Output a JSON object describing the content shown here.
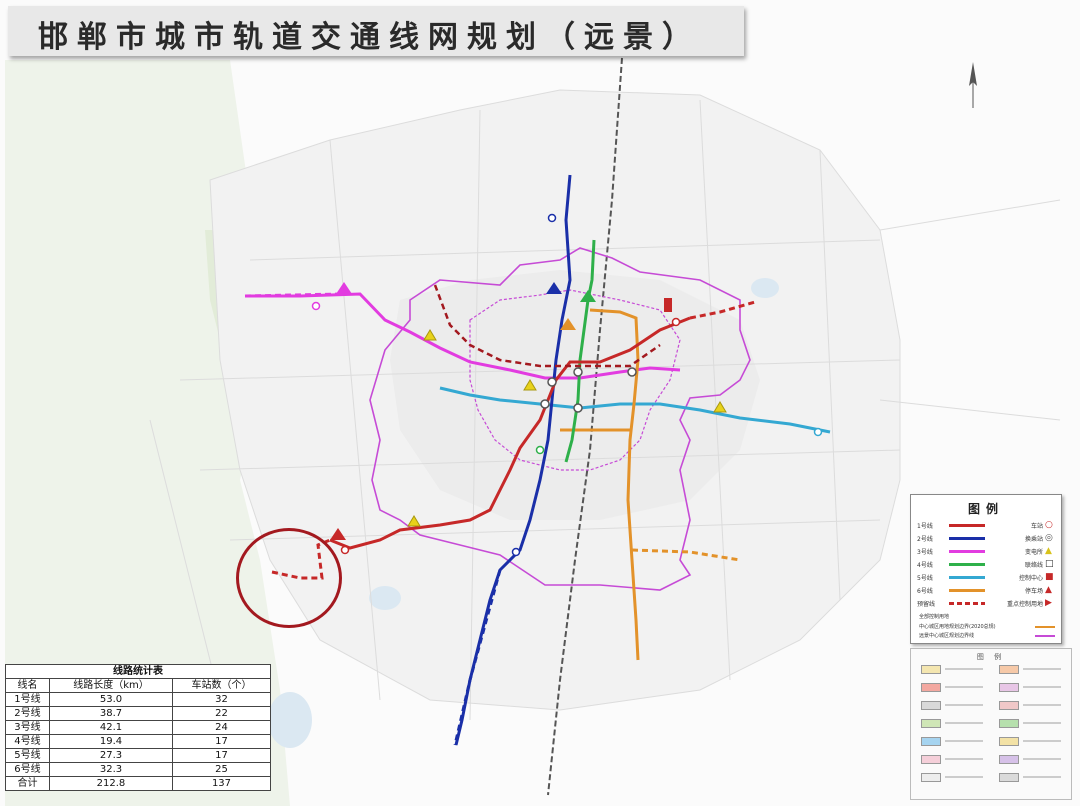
{
  "map": {
    "title": "邯郸市城市轨道交通线网规划（远景）"
  },
  "line_colors": {
    "line1": "#c62828",
    "line2": "#1a2fa8",
    "line3": "#e23ce0",
    "line4": "#2eb04a",
    "line5": "#34a8d2",
    "line6": "#e3922a",
    "planning_boundary": "#c64bd6",
    "railway": "#444444"
  },
  "stats_table": {
    "title": "线路统计表",
    "headers": [
      "线名",
      "线路长度（km）",
      "车站数（个）"
    ],
    "rows": [
      [
        "1号线",
        "53.0",
        "32"
      ],
      [
        "2号线",
        "38.7",
        "22"
      ],
      [
        "3号线",
        "42.1",
        "24"
      ],
      [
        "4号线",
        "19.4",
        "17"
      ],
      [
        "5号线",
        "27.3",
        "17"
      ],
      [
        "6号线",
        "32.3",
        "25"
      ],
      [
        "合计",
        "212.8",
        "137"
      ]
    ]
  },
  "legend": {
    "title": "图例",
    "rows": [
      {
        "name": "1号线",
        "color": "#c62828",
        "dashed": false,
        "symbol_name": "车站",
        "symbol": "○",
        "symbol_color": "#c62828"
      },
      {
        "name": "2号线",
        "color": "#1a2fa8",
        "dashed": false,
        "symbol_name": "换乘站",
        "symbol": "◎",
        "symbol_color": "#555555"
      },
      {
        "name": "3号线",
        "color": "#e23ce0",
        "dashed": false,
        "symbol_name": "变电所",
        "symbol": "▲",
        "symbol_color": "#d8c21a"
      },
      {
        "name": "4号线",
        "color": "#2eb04a",
        "dashed": false,
        "symbol_name": "联络线",
        "symbol": "□",
        "symbol_color": "#222222"
      },
      {
        "name": "5号线",
        "color": "#34a8d2",
        "dashed": false,
        "symbol_name": "控制中心",
        "symbol": "■",
        "symbol_color": "#c62828"
      },
      {
        "name": "6号线",
        "color": "#e3922a",
        "dashed": false,
        "symbol_name": "停车场",
        "symbol": "▲",
        "symbol_color": "#c62828"
      },
      {
        "name": "预留线",
        "color": "#c62828",
        "dashed": true,
        "symbol_name": "重点控制用地",
        "symbol": "▶",
        "symbol_color": "#c62828"
      }
    ],
    "extra_label": "全部控制用地",
    "footer": [
      {
        "text": "中心城区用地规划边界(2020总规)",
        "color": "#e3922a"
      },
      {
        "text": "远景中心城区规划边界线",
        "color": "#c64bd6"
      }
    ]
  },
  "landuse_legend": {
    "title": "图 例",
    "colors": [
      "#f4e6b0",
      "#f6c9a8",
      "#f3a8a0",
      "#e8c6e6",
      "#d9d9d9",
      "#f0c8c8",
      "#cfe6b6",
      "#b6e0ad",
      "#a6d4f0",
      "#f3e2a6",
      "#f5cfd9",
      "#d6c1e8",
      "#ededed",
      "#dadada"
    ]
  }
}
